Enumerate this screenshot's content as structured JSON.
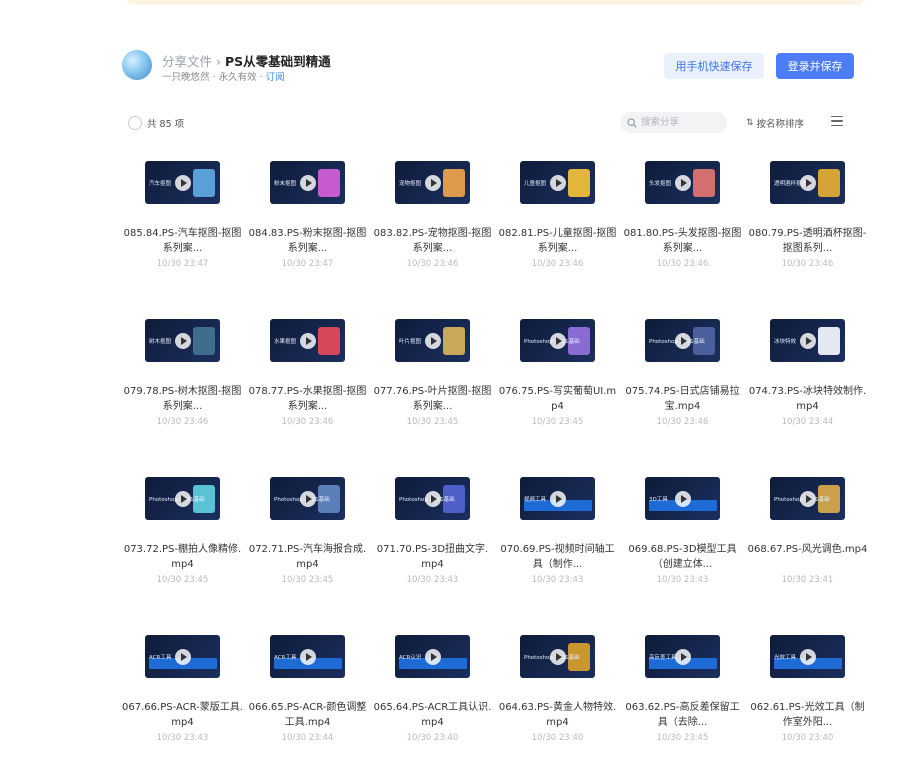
{
  "header": {
    "breadcrumb_root": "分享文件",
    "separator": "›",
    "folder_title": "PS从零基础到精通",
    "sharer": "一只晚悠然",
    "validity": "· 永久有效 ·",
    "subscribe": "订阅",
    "mobile_save_button": "用手机快速保存",
    "login_save_button": "登录并保存"
  },
  "toolbar": {
    "count_label": "共 85 项",
    "search_placeholder": "搜索分享",
    "sort_label": "按名称排序"
  },
  "files": [
    {
      "name": "085.84.PS-汽车抠图-抠图系列案...",
      "time": "10/30 23:47",
      "thumb": "汽车抠图"
    },
    {
      "name": "084.83.PS-粉末抠图-抠图系列案...",
      "time": "10/30 23:47",
      "thumb": "粉末抠图"
    },
    {
      "name": "083.82.PS-宠物抠图-抠图系列案...",
      "time": "10/30 23:46",
      "thumb": "宠物抠图"
    },
    {
      "name": "082.81.PS-儿童抠图-抠图系列案...",
      "time": "10/30 23:46",
      "thumb": "儿童抠图"
    },
    {
      "name": "081.80.PS-头发抠图-抠图系列案...",
      "time": "10/30 23:46",
      "thumb": "头发抠图"
    },
    {
      "name": "080.79.PS-透明酒杯抠图-抠图系列...",
      "time": "10/30 23:46",
      "thumb": "透明酒杯抠图"
    },
    {
      "name": "079.78.PS-树木抠图-抠图系列案...",
      "time": "10/30 23:46",
      "thumb": "树木抠图"
    },
    {
      "name": "078.77.PS-水果抠图-抠图系列案...",
      "time": "10/30 23:46",
      "thumb": "水果抠图"
    },
    {
      "name": "077.76.PS-叶片抠图-抠图系列案...",
      "time": "10/30 23:45",
      "thumb": "叶片抠图"
    },
    {
      "name": "076.75.PS-写实葡萄UI.mp4",
      "time": "10/30 23:45",
      "thumb": "Photoshop 2021基础"
    },
    {
      "name": "075.74.PS-日式店铺易拉宝.mp4",
      "time": "10/30 23:46",
      "thumb": "Photoshop 2021基础"
    },
    {
      "name": "074.73.PS-冰块特效制作.mp4",
      "time": "10/30 23:44",
      "thumb": "冰块特效"
    },
    {
      "name": "073.72.PS-棚拍人像精修.mp4",
      "time": "10/30 23:45",
      "thumb": "Photoshop 2021基础"
    },
    {
      "name": "072.71.PS-汽车海报合成.mp4",
      "time": "10/30 23:45",
      "thumb": "Photoshop 2021基础"
    },
    {
      "name": "071.70.PS-3D扭曲文字.mp4",
      "time": "10/30 23:43",
      "thumb": "Photoshop 2021基础"
    },
    {
      "name": "070.69.PS-视频时间轴工具（制作...",
      "time": "10/30 23:43",
      "thumb": "视频工具"
    },
    {
      "name": "069.68.PS-3D模型工具（创建立体...",
      "time": "10/30 23:43",
      "thumb": "3D工具"
    },
    {
      "name": "068.67.PS-风光调色.mp4",
      "time": "10/30 23:41",
      "thumb": "Photoshop 2021基础"
    },
    {
      "name": "067.66.PS-ACR-蒙版工具.mp4",
      "time": "10/30 23:43",
      "thumb": "ACR工具"
    },
    {
      "name": "066.65.PS-ACR-颜色调整工具.mp4",
      "time": "10/30 23:44",
      "thumb": "ACR工具"
    },
    {
      "name": "065.64.PS-ACR工具认识.mp4",
      "time": "10/30 23:40",
      "thumb": "ACR认识"
    },
    {
      "name": "064.63.PS-黄金人物特效.mp4",
      "time": "10/30 23:40",
      "thumb": "Photoshop 2021基础"
    },
    {
      "name": "063.62.PS-高反差保留工具（去除...",
      "time": "10/30 23:45",
      "thumb": "高反差工具"
    },
    {
      "name": "062.61.PS-光效工具（制作室外阳...",
      "time": "10/30 23:40",
      "thumb": "光效工具"
    }
  ],
  "colors": {
    "primary": "#4d7cf4",
    "primary_light": "#eaf1fd",
    "link": "#3d8cf5",
    "banner": "#fdf3e6"
  }
}
